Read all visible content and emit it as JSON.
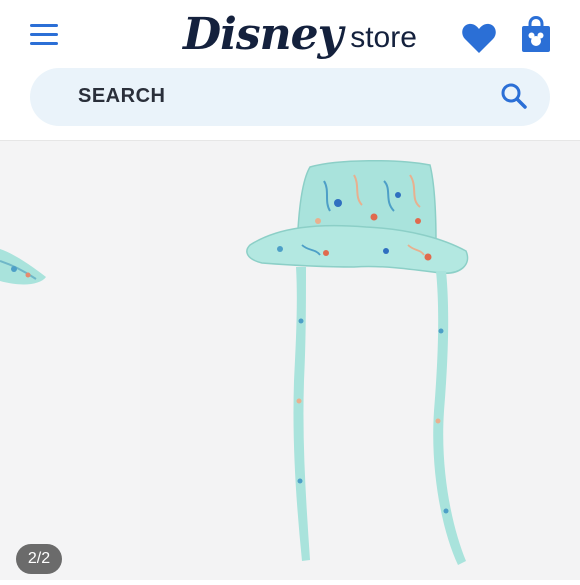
{
  "header": {
    "logo_word": "Disney",
    "logo_store": "store",
    "menu_icon": "hamburger-menu-icon",
    "wishlist_icon": "heart-icon",
    "bag_icon": "shopping-bag-icon"
  },
  "search": {
    "label": "SEARCH",
    "icon": "search-icon"
  },
  "gallery": {
    "counter": "2/2"
  },
  "colors": {
    "brand_blue": "#2b6fd6",
    "logo_navy": "#14213d",
    "search_bg": "#eaf3fa",
    "gallery_bg": "#f3f3f4",
    "hat_mint": "#a9e3dc"
  }
}
